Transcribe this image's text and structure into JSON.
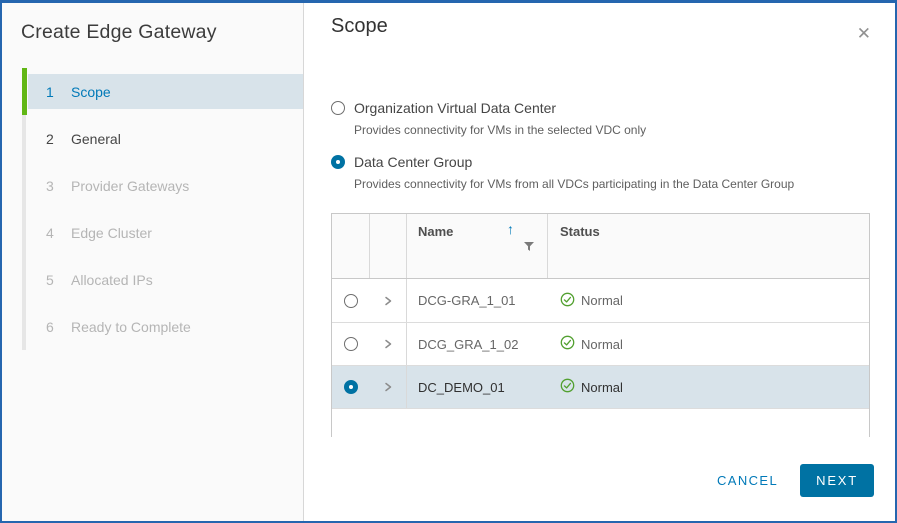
{
  "window": {
    "title": "Create Edge Gateway"
  },
  "icons": {
    "close": "✕",
    "sort_ascending": "↑",
    "filter": "funnel-icon",
    "expand": "chevron-right-icon",
    "status_ok": "check-circle-icon"
  },
  "steps": [
    {
      "num": "1",
      "label": "Scope",
      "state": "active"
    },
    {
      "num": "2",
      "label": "General",
      "state": "enabled"
    },
    {
      "num": "3",
      "label": "Provider Gateways",
      "state": "disabled"
    },
    {
      "num": "4",
      "label": "Edge Cluster",
      "state": "disabled"
    },
    {
      "num": "5",
      "label": "Allocated IPs",
      "state": "disabled"
    },
    {
      "num": "6",
      "label": "Ready to Complete",
      "state": "disabled"
    }
  ],
  "panel": {
    "title": "Scope",
    "options": [
      {
        "label": "Organization Virtual Data Center",
        "description": "Provides connectivity for VMs in the selected VDC only",
        "selected": false
      },
      {
        "label": "Data Center Group",
        "description": "Provides connectivity for VMs from all VDCs participating in the Data Center Group",
        "selected": true
      }
    ],
    "table": {
      "headers": {
        "name": "Name",
        "status": "Status"
      },
      "sort": {
        "column": "Name",
        "direction": "ascending"
      },
      "rows": [
        {
          "name": "DCG-GRA_1_01",
          "status": "Normal",
          "selected": false
        },
        {
          "name": "DCG_GRA_1_02",
          "status": "Normal",
          "selected": false
        },
        {
          "name": "DC_DEMO_01",
          "status": "Normal",
          "selected": true
        }
      ]
    },
    "footer": {
      "cancel_label": "CANCEL",
      "next_label": "NEXT"
    }
  },
  "colors": {
    "accent_blue": "#0072a3",
    "link_blue": "#0079b8",
    "success_green": "#48960c",
    "active_step_bar_green": "#61b715",
    "selected_row_bg": "#d8e3ea",
    "dialog_border_blue": "#2566af",
    "sidebar_bg": "#fafafa"
  }
}
